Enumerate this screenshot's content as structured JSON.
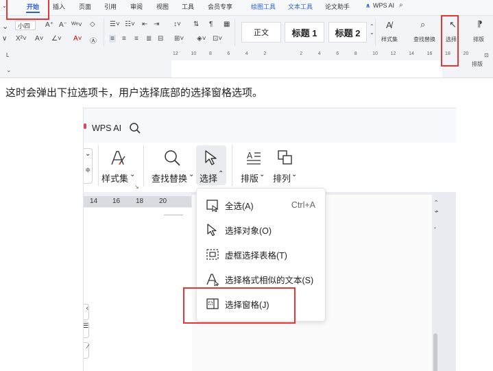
{
  "ribbon": {
    "tabs": [
      "开始",
      "插入",
      "页面",
      "引用",
      "审阅",
      "视图",
      "工具",
      "会员专享",
      "绘图工具",
      "文本工具",
      "论文助手"
    ],
    "active_tab": "开始",
    "wps_ai": "WPS AI",
    "font_size": "小四",
    "styles": [
      "正文",
      "标题 1",
      "标题 2"
    ],
    "tool_labels": {
      "style_set": "样式集",
      "find_replace": "查找替换",
      "select": "选择",
      "arrange": "排版"
    },
    "ruler_ticks": [
      "12",
      "10",
      "8",
      "6",
      "4",
      "2",
      "",
      "2",
      "4",
      "6",
      "8",
      "10",
      "12",
      "14",
      "16",
      "18",
      "20"
    ],
    "arrange_bottom": "排版",
    "accent": "#2b5fd9",
    "highlight": "#e53535"
  },
  "article": {
    "text": "这时会弹出下拉选项卡，用户选择底部的选择窗格选项。"
  },
  "shot": {
    "wps_ai": "WPS AI",
    "toolbar": {
      "style_set": "样式集",
      "find_replace": "查找替换",
      "select": "选择",
      "layout": "排版",
      "arrange": "排列"
    },
    "ruler_ticks": [
      "14",
      "16",
      "18",
      "20"
    ],
    "menu": [
      {
        "label": "全选(A)",
        "shortcut": "Ctrl+A",
        "icon": "select-all-icon"
      },
      {
        "label": "选择对象(O)",
        "shortcut": "",
        "icon": "cursor-icon"
      },
      {
        "label": "虚框选择表格(T)",
        "shortcut": "",
        "icon": "dashed-table-icon"
      },
      {
        "label": "选择格式相似的文本(S)",
        "shortcut": "",
        "icon": "similar-format-icon"
      },
      {
        "label": "选择窗格(J)",
        "shortcut": "",
        "icon": "selection-pane-icon"
      }
    ]
  }
}
